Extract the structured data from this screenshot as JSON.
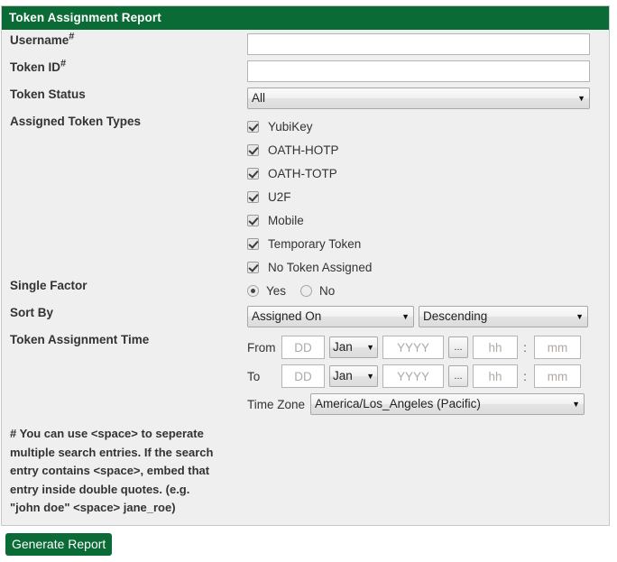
{
  "panel": {
    "title": "Token Assignment Report"
  },
  "fields": {
    "username": {
      "label": "Username",
      "marker": "#",
      "value": "",
      "placeholder": ""
    },
    "token_id": {
      "label": "Token ID",
      "marker": "#",
      "value": "",
      "placeholder": ""
    },
    "token_status": {
      "label": "Token Status",
      "value": "All"
    },
    "assigned_token_types": {
      "label": "Assigned Token Types",
      "items": [
        {
          "label": "YubiKey",
          "checked": true
        },
        {
          "label": "OATH-HOTP",
          "checked": true
        },
        {
          "label": "OATH-TOTP",
          "checked": true
        },
        {
          "label": "U2F",
          "checked": true
        },
        {
          "label": "Mobile",
          "checked": true
        },
        {
          "label": "Temporary Token",
          "checked": true
        },
        {
          "label": "No Token Assigned",
          "checked": true
        }
      ]
    },
    "single_factor": {
      "label": "Single Factor",
      "options": [
        {
          "label": "Yes",
          "selected": true
        },
        {
          "label": "No",
          "selected": false
        }
      ]
    },
    "sort_by": {
      "label": "Sort By",
      "key_value": "Assigned On",
      "direction_value": "Descending"
    },
    "token_assignment_time": {
      "label": "Token Assignment Time",
      "from": {
        "prefix": "From",
        "day_placeholder": "DD",
        "month_value": "Jan",
        "year_placeholder": "YYYY",
        "calendar_button": "...",
        "hour_placeholder": "hh",
        "separator": ":",
        "minute_placeholder": "mm"
      },
      "to": {
        "prefix": "To",
        "day_placeholder": "DD",
        "month_value": "Jan",
        "year_placeholder": "YYYY",
        "calendar_button": "...",
        "hour_placeholder": "hh",
        "separator": ":",
        "minute_placeholder": "mm"
      },
      "timezone": {
        "label": "Time Zone",
        "value": "America/Los_Angeles (Pacific)"
      }
    }
  },
  "note": {
    "lines": [
      "# You can use <space> to seperate",
      "multiple search entries. If the search",
      "entry contains <space>, embed that",
      "entry inside double quotes. (e.g.",
      "\"john doe\" <space> jane_roe)"
    ]
  },
  "actions": {
    "generate_report": "Generate Report"
  },
  "icons": {
    "caret_down": "▼"
  },
  "colors": {
    "header_green": "#0a6b36",
    "panel_background": "#efefef",
    "button_green": "#0a6b36"
  }
}
